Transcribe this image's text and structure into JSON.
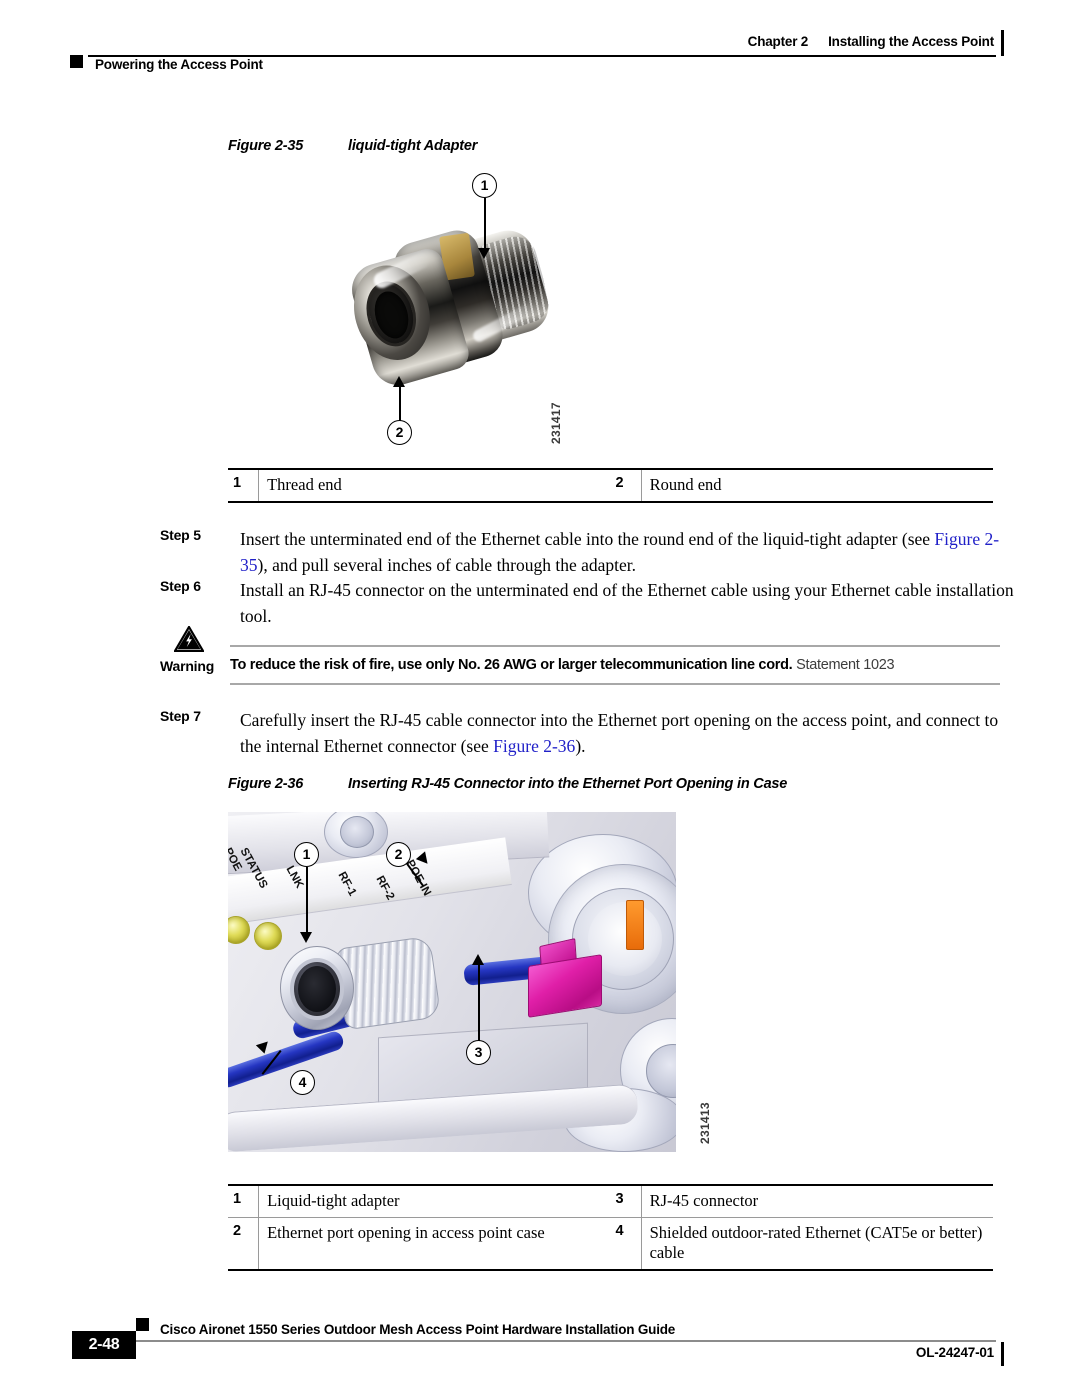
{
  "header": {
    "chapter": "Chapter 2",
    "chapter_title": "Installing the Access Point",
    "section": "Powering the Access Point"
  },
  "figure_35": {
    "caption_number": "Figure 2-35",
    "caption_title": "liquid-tight Adapter",
    "image_id": "231417",
    "callouts": [
      {
        "number": "1",
        "label": "Thread end"
      },
      {
        "number": "2",
        "label": "Round end"
      }
    ],
    "legend": [
      {
        "n1": "1",
        "t1": "Thread end",
        "n2": "2",
        "t2": "Round end"
      }
    ]
  },
  "steps": [
    {
      "label": "Step 5",
      "text_before": "Insert the unterminated end of the Ethernet cable into the round end of the liquid-tight adapter (see ",
      "xref": "Figure 2-35",
      "text_after": "), and pull several inches of cable through the adapter."
    },
    {
      "label": "Step 6",
      "text_before": "Install an RJ-45 connector on the unterminated end of the Ethernet cable using your Ethernet cable installation tool.",
      "xref": "",
      "text_after": ""
    },
    {
      "label": "Step 7",
      "text_before": "Carefully insert the RJ-45 cable connector into the Ethernet port opening on the access point, and connect to the internal Ethernet connector (see ",
      "xref": "Figure 2-36",
      "text_after": ")."
    }
  ],
  "warning": {
    "label": "Warning",
    "icon": "warning-lightning-triangle-icon",
    "bold_text": "To reduce the risk of fire, use only No. 26 AWG or larger telecommunication line cord.",
    "statement": "Statement 1023"
  },
  "figure_36": {
    "caption_number": "Figure 2-36",
    "caption_title": "Inserting RJ-45 Connector into the Ethernet Port Opening in Case",
    "image_id": "231413",
    "led_labels": [
      "STATUS",
      "POE",
      "LNK",
      "RF-1",
      "RF-2",
      "POE IN"
    ],
    "callouts": [
      {
        "number": "1",
        "label": "Liquid-tight adapter"
      },
      {
        "number": "2",
        "label": "Ethernet port opening in access point case"
      },
      {
        "number": "3",
        "label": "RJ-45 connector"
      },
      {
        "number": "4",
        "label": "Shielded outdoor-rated Ethernet (CAT5e or better) cable"
      }
    ],
    "legend": [
      {
        "n1": "1",
        "t1": "Liquid-tight adapter",
        "n2": "3",
        "t2": "RJ-45 connector"
      },
      {
        "n1": "2",
        "t1": "Ethernet port opening in access point case",
        "n2": "4",
        "t2": "Shielded outdoor-rated Ethernet (CAT5e or better) cable"
      }
    ]
  },
  "footer": {
    "page_number": "2-48",
    "guide_title": "Cisco Aironet 1550 Series Outdoor Mesh Access Point Hardware Installation Guide",
    "doc_number": "OL-24247-01"
  },
  "colors": {
    "xref_link": "#2020c8",
    "rule": "#000000",
    "connector_magenta": "#e01fa8",
    "cable_blue": "#2536c2",
    "led_yellow": "#e0dc58"
  }
}
